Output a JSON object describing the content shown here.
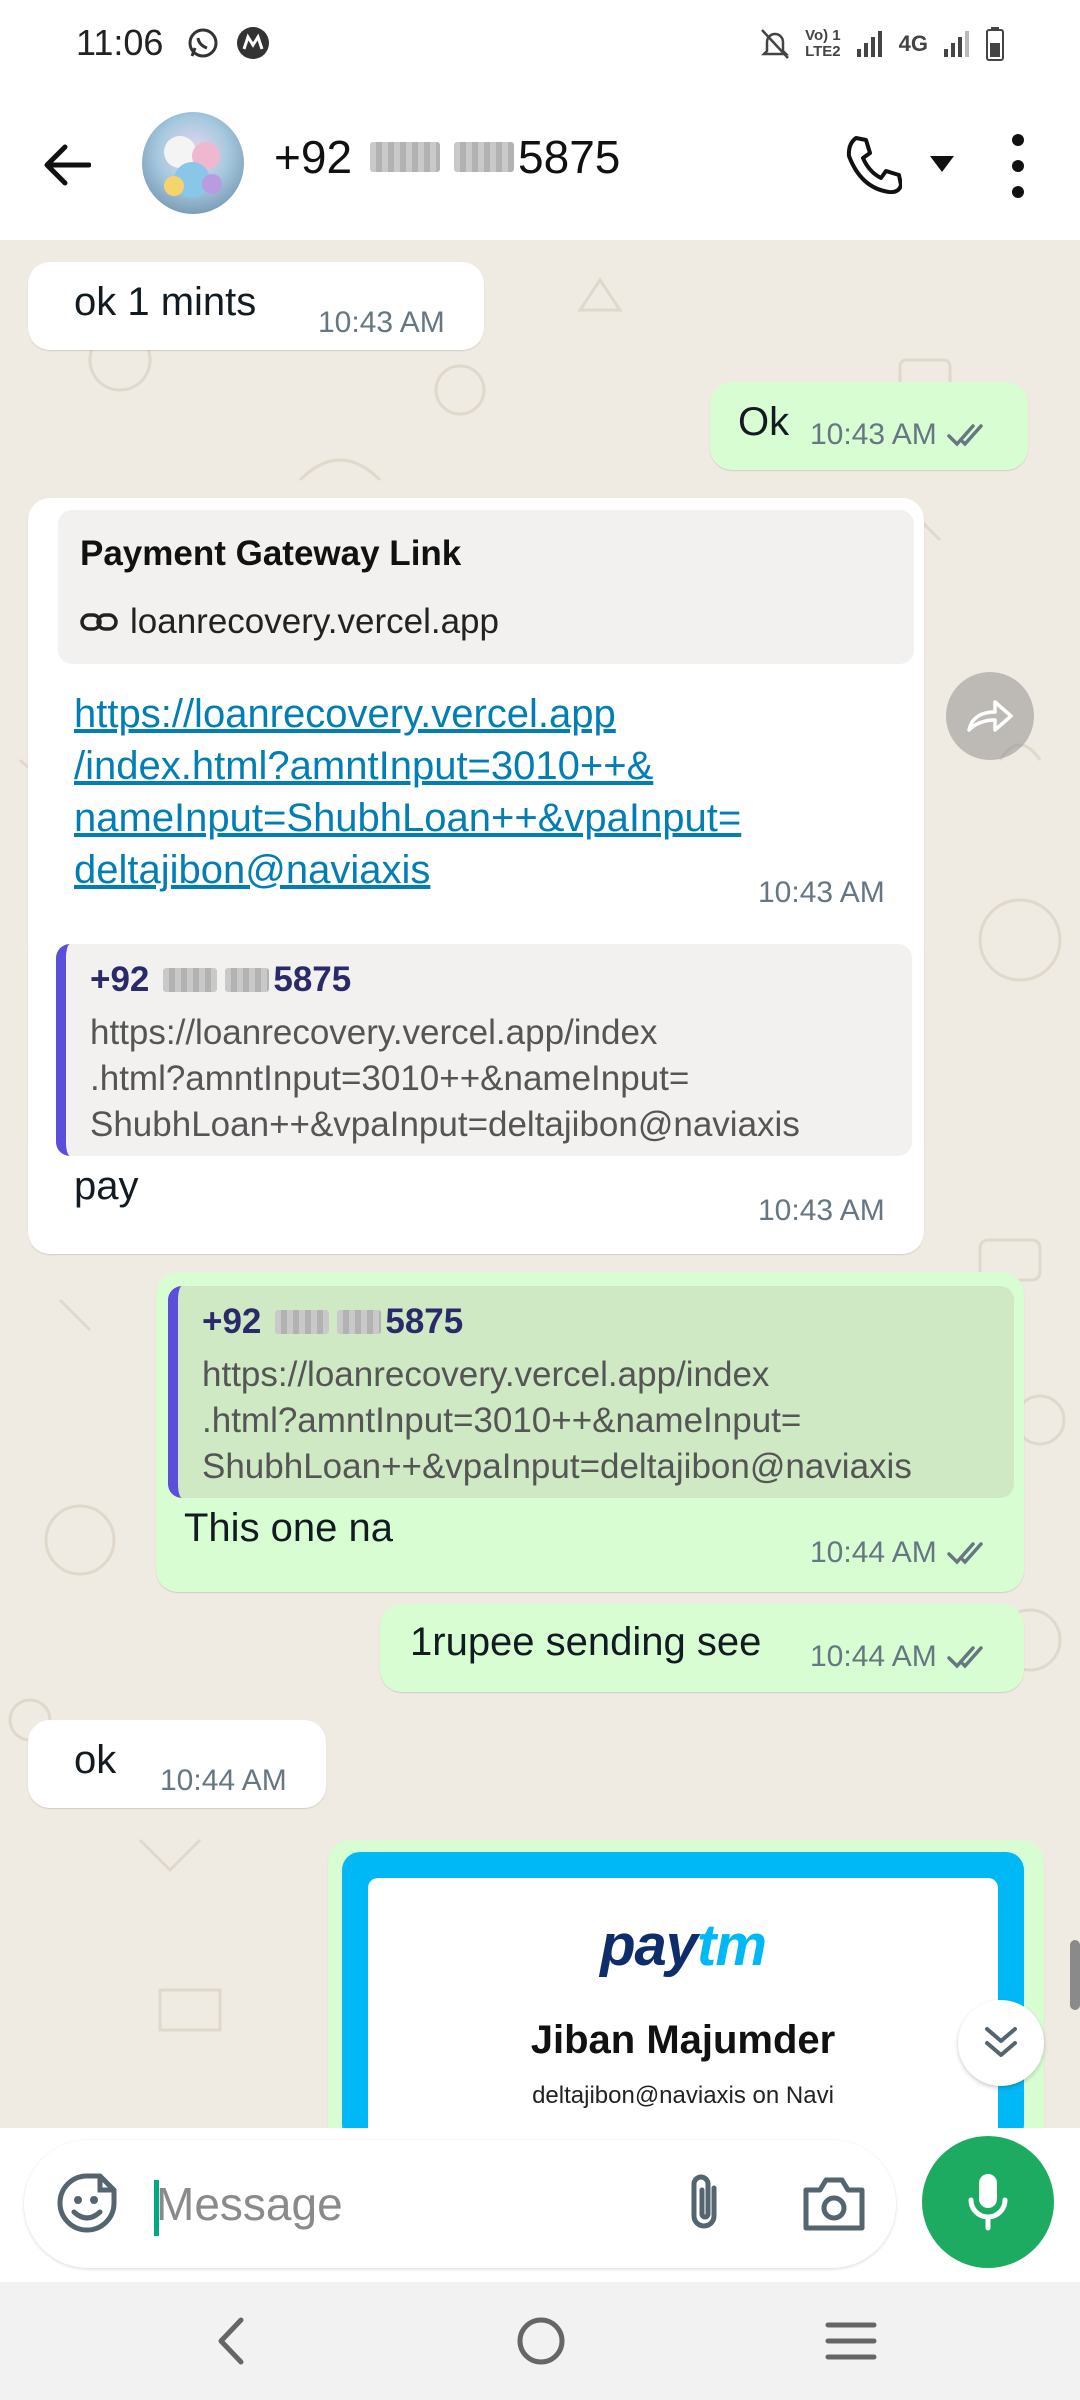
{
  "status_bar": {
    "time": "11:06",
    "network": "4G",
    "volte": "Vo) 1",
    "lte": "LTE2",
    "icons": [
      "whatsapp-icon",
      "app-m-icon",
      "mute-icon",
      "signal-icon",
      "signal-icon",
      "battery-icon"
    ]
  },
  "header": {
    "contact_prefix": "+92",
    "contact_suffix": "5875",
    "icons": [
      "back-arrow-icon",
      "phone-icon",
      "caret-down-icon",
      "more-vertical-icon"
    ]
  },
  "messages": [
    {
      "dir": "in",
      "text": "ok 1 mints",
      "time": "10:43 AM"
    },
    {
      "dir": "out",
      "text": "Ok",
      "time": "10:43 AM",
      "read": true
    },
    {
      "dir": "in",
      "preview_title": "Payment Gateway Link",
      "preview_domain": "loanrecovery.vercel.app",
      "link_lines": [
        "https://loanrecovery.vercel.app",
        "/index.html?amntInput=3010++&",
        "nameInput=ShubhLoan++&vpaInput=",
        "deltajibon@naviaxis"
      ],
      "time": "10:43 AM"
    },
    {
      "dir": "in",
      "quote_author_prefix": "+92",
      "quote_author_suffix": "5875",
      "quote_lines": [
        "https://loanrecovery.vercel.app/index",
        ".html?amntInput=3010++&nameInput=",
        "ShubhLoan++&vpaInput=deltajibon@naviaxis"
      ],
      "text": "pay",
      "time": "10:43 AM"
    },
    {
      "dir": "out",
      "quote_author_prefix": "+92",
      "quote_author_suffix": "5875",
      "quote_lines": [
        "https://loanrecovery.vercel.app/index",
        ".html?amntInput=3010++&nameInput=",
        "ShubhLoan++&vpaInput=deltajibon@naviaxis"
      ],
      "text": "This one na",
      "time": "10:44 AM",
      "read": true
    },
    {
      "dir": "out",
      "text": "1rupee sending see",
      "time": "10:44 AM",
      "read": true
    },
    {
      "dir": "in",
      "text": "ok",
      "time": "10:44 AM"
    }
  ],
  "paytm_card": {
    "logo_a": "pay",
    "logo_b": "tm",
    "name": "Jiban Majumder",
    "vpa": "deltajibon@naviaxis on Navi"
  },
  "composer": {
    "placeholder": "Message"
  },
  "colors": {
    "chat_bg": "#efeae2",
    "outgoing": "#d9fdd3",
    "incoming": "#ffffff",
    "link": "#027eb5",
    "read_ticks": "#53bdeb",
    "mic_button": "#1daa61",
    "quote_bar": "#5b4ed8",
    "paytm_blue": "#00b8f5"
  }
}
